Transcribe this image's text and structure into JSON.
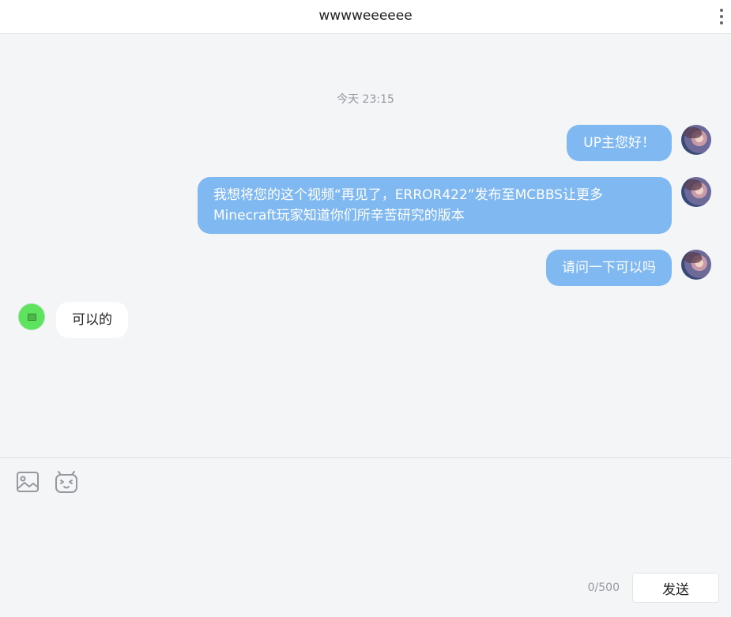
{
  "header": {
    "title": "wwwweeeeee",
    "menu_icon": "more-vertical-icon"
  },
  "conversation": {
    "timestamp": "今天 23:15",
    "messages": [
      {
        "sender": "self",
        "text": "UP主您好！"
      },
      {
        "sender": "self",
        "lines": [
          "我想将您的这个视频“再见了，ERROR422”发布至MCBBS让更多",
          "Minecraft玩家知道你们所辛苦研究的版本"
        ]
      },
      {
        "sender": "self",
        "text": "请问一下可以吗"
      },
      {
        "sender": "other",
        "text": "可以的"
      }
    ]
  },
  "composer": {
    "image_icon": "image-icon",
    "emoji_icon": "bilibili-emoji-icon",
    "counter": "0/500",
    "send_label": "发送",
    "value": ""
  },
  "colors": {
    "self_bubble": "#80b9f2",
    "other_bubble": "#ffffff",
    "background": "#f4f5f7"
  }
}
